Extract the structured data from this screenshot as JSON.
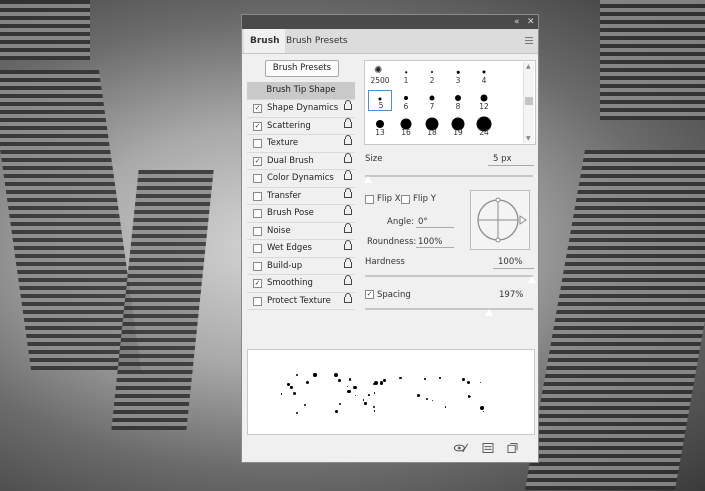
{
  "panel": {
    "tabs": [
      "Brush",
      "Brush Presets"
    ],
    "presets_button": "Brush Presets",
    "options": [
      {
        "label": "Brush Tip Shape",
        "checked": null,
        "lock": false
      },
      {
        "label": "Shape Dynamics",
        "checked": true,
        "lock": true
      },
      {
        "label": "Scattering",
        "checked": true,
        "lock": true
      },
      {
        "label": "Texture",
        "checked": false,
        "lock": true
      },
      {
        "label": "Dual Brush",
        "checked": true,
        "lock": true
      },
      {
        "label": "Color Dynamics",
        "checked": false,
        "lock": true
      },
      {
        "label": "Transfer",
        "checked": false,
        "lock": true
      },
      {
        "label": "Brush Pose",
        "checked": false,
        "lock": true
      },
      {
        "label": "Noise",
        "checked": false,
        "lock": true
      },
      {
        "label": "Wet Edges",
        "checked": false,
        "lock": true
      },
      {
        "label": "Build-up",
        "checked": false,
        "lock": true
      },
      {
        "label": "Smoothing",
        "checked": true,
        "lock": true
      },
      {
        "label": "Protect Texture",
        "checked": false,
        "lock": true
      }
    ],
    "tips": [
      {
        "num": "2500",
        "size": 0,
        "icon": "scatter-brush-icon"
      },
      {
        "num": "1",
        "size": 1.5
      },
      {
        "num": "2",
        "size": 2
      },
      {
        "num": "3",
        "size": 2.5
      },
      {
        "num": "4",
        "size": 3
      },
      {
        "num": "5",
        "size": 3,
        "selected": true
      },
      {
        "num": "6",
        "size": 4
      },
      {
        "num": "7",
        "size": 5
      },
      {
        "num": "8",
        "size": 6
      },
      {
        "num": "12",
        "size": 7
      },
      {
        "num": "13",
        "size": 8
      },
      {
        "num": "16",
        "size": 11
      },
      {
        "num": "18",
        "size": 13
      },
      {
        "num": "19",
        "size": 13
      },
      {
        "num": "24",
        "size": 15
      }
    ],
    "size_label": "Size",
    "size_value": "5 px",
    "flip_x": "Flip X",
    "flip_y": "Flip Y",
    "angle_label": "Angle:",
    "angle_value": "0°",
    "roundness_label": "Roundness:",
    "roundness_value": "100%",
    "hardness_label": "Hardness",
    "hardness_value": "100%",
    "spacing_label": "Spacing",
    "spacing_value": "197%",
    "spacing_checked": true
  }
}
